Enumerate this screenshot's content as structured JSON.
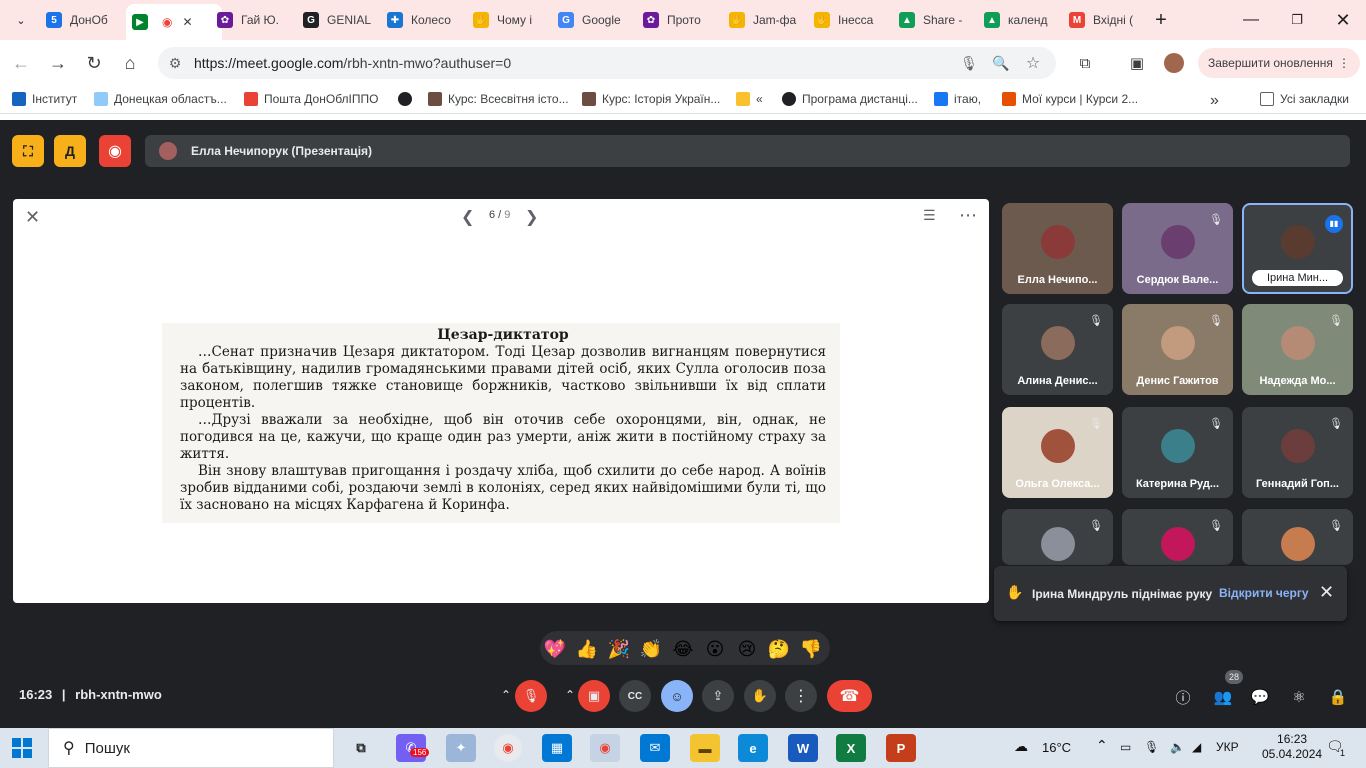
{
  "browser": {
    "tabs": [
      {
        "label": "ДонОб",
        "color": "#1a73e8",
        "glyph": "5"
      },
      {
        "label": "",
        "color": "#00832d",
        "glyph": "▶"
      },
      {
        "label": "Гай Ю.",
        "color": "#6a1b9a",
        "glyph": "✿"
      },
      {
        "label": "GENIAL",
        "color": "#202124",
        "glyph": "G"
      },
      {
        "label": "Колесо",
        "color": "#1976d2",
        "glyph": "✚"
      },
      {
        "label": "Чому і",
        "color": "#f4b400",
        "glyph": "✋"
      },
      {
        "label": "Google",
        "color": "#4285f4",
        "glyph": "G"
      },
      {
        "label": "Прото",
        "color": "#6a1b9a",
        "glyph": "✿"
      },
      {
        "label": "Jam-фа",
        "color": "#f4b400",
        "glyph": "✋"
      },
      {
        "label": "Інесса",
        "color": "#f4b400",
        "glyph": "✋"
      },
      {
        "label": "Share -",
        "color": "#0f9d58",
        "glyph": "▲"
      },
      {
        "label": "календ",
        "color": "#0f9d58",
        "glyph": "▲"
      },
      {
        "label": "Вхідні (",
        "color": "#ea4335",
        "glyph": "M"
      }
    ],
    "url_host": "https://meet.google.com",
    "url_path": "/rbh-xntn-mwo?authuser=0",
    "update_label": "Завершити оновлення",
    "bookmarks": [
      {
        "label": "Інститут",
        "color": "#1565c0"
      },
      {
        "label": "Донецкая областъ...",
        "color": "#90caf9"
      },
      {
        "label": "Пошта ДонОблІППО",
        "color": "#ea4335"
      },
      {
        "label": "",
        "color": "#202124"
      },
      {
        "label": "Курс: Всесвітня істо...",
        "color": "#6d4c41"
      },
      {
        "label": "Курс: Історія Україн...",
        "color": "#6d4c41"
      },
      {
        "label": "«",
        "color": "#fbc02d"
      },
      {
        "label": "Програма дистанці...",
        "color": "#202124"
      },
      {
        "label": "ітаю,",
        "color": "#1877f2"
      },
      {
        "label": "Мої курси | Курси 2...",
        "color": "#e65100"
      }
    ],
    "all_bookmarks_label": "Усі закладки"
  },
  "meet": {
    "presenter_label": "Елла Нечипорук (Презентація)",
    "slide_page": "6",
    "slide_total": "9",
    "slide_title": "Цезар-диктатор",
    "slide_paragraphs": [
      "…Сенат призначив Цезаря диктатором. Тоді Цезар дозволив вигнанцям повернутися на батьківщину, надилив громадянськими правами дітей осіб, яких Сулла оголосив поза законом, полегшив тяжке становище боржників, частково звільнивши їх від сплати процентів.",
      "…Друзі вважали за необхідне, щоб він оточив себе охоронцями, він, однак, не погодився на це, кажучи, що краще один раз умерти, аніж жити в постійному страху за життя.",
      "Він знову влаштував пригощання і роздачу хліба, щоб схилити до себе народ. А воїнів зробив відданими собі, роздаючи землі в колоніях, серед яких найвідомішими були ті, що їх засновано на місцях Карфагена й Коринфа."
    ],
    "participants": [
      {
        "name": "Елла Нечипо...",
        "bg": "#6d5a4e",
        "face": "#8b3a3a"
      },
      {
        "name": "Сердюк Вале...",
        "bg": "#7a6b8a",
        "face": "#6a3f6f"
      },
      {
        "name": "Ірина Мин...",
        "bg": "#3c4043",
        "face": "#5a3b30"
      },
      {
        "name": "Алина Денис...",
        "bg": "#3c4043",
        "face": "#8b6b5b"
      },
      {
        "name": "Денис Гажитов",
        "bg": "#8a7a68",
        "face": "#c29a7e"
      },
      {
        "name": "Надежда Мо...",
        "bg": "#7f8a78",
        "face": "#b58b76"
      },
      {
        "name": "Ольга Олекса...",
        "bg": "#ddd4c8",
        "face": "#a0523d"
      },
      {
        "name": "Катерина Руд...",
        "bg": "#3c4043",
        "face": "#3a7f8a"
      },
      {
        "name": "Геннадий Гоп...",
        "bg": "#3c4043",
        "face": "#6b3d3d"
      },
      {
        "name": "",
        "bg": "#3c4043",
        "face": "#8a8f9a"
      },
      {
        "name": "",
        "bg": "#3c4043",
        "face": "#c2185b"
      },
      {
        "name": "",
        "bg": "#3c4043",
        "face": "#c67c4e"
      }
    ],
    "toast_text": "Ірина Миндруль піднімає руку",
    "toast_link": "Відкрити чергу",
    "reactions": [
      "💖",
      "👍",
      "🎉",
      "👏",
      "😂",
      "😮",
      "😢",
      "🤔",
      "👎"
    ],
    "time": "16:23",
    "separator": "|",
    "meeting_code": "rbh-xntn-mwo",
    "people_count": "28"
  },
  "taskbar": {
    "search_placeholder": "Пошук",
    "weather": "16°C",
    "language": "УКР",
    "clock_time": "16:23",
    "clock_date": "05.04.2024",
    "notif_count": "1",
    "viber_badge": "156"
  }
}
